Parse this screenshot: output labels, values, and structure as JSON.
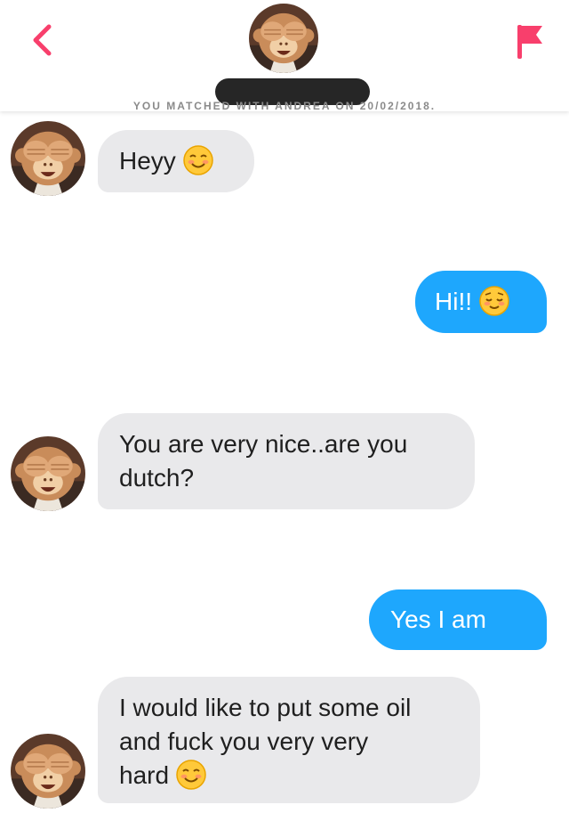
{
  "header": {
    "back_icon": "chevron-left-icon",
    "flag_icon": "flag-icon",
    "matched_text": "YOU MATCHED WITH ANDREA ON 20/02/2018.",
    "accent": "#f83f6c"
  },
  "messages": [
    {
      "side": "incoming",
      "text": "Heyy",
      "emoji": "smiling-face-icon"
    },
    {
      "side": "outgoing",
      "text": "Hi!!",
      "emoji": "relieved-face-icon"
    },
    {
      "side": "incoming",
      "lines": [
        "You are very nice..are you",
        "dutch?"
      ]
    },
    {
      "side": "outgoing",
      "text": "Yes I am"
    },
    {
      "side": "incoming",
      "lines": [
        "I would like to put some oil",
        "and fuck you very very",
        "hard"
      ],
      "emoji": "smiling-face-icon"
    }
  ],
  "colors": {
    "outgoing_bubble": "#1ea7fd",
    "incoming_bubble": "#e9e9eb"
  }
}
